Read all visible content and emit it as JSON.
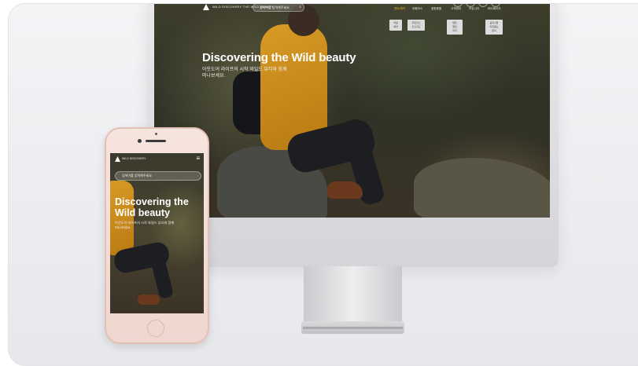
{
  "desktop": {
    "logo_text": "WILD DISCOVERY THE WILD BEAUTY",
    "search_placeholder": "검색어를 입력해주세요",
    "menu": [
      "렌트/예약",
      "여행코스",
      "캠핑용품",
      "고객센터",
      "커뮤니티",
      "마이페이지"
    ],
    "submenus": [
      {
        "items": [
          "차량",
          "예약"
        ]
      },
      {
        "items": [
          "추천코스",
          "코스지도"
        ]
      },
      {
        "items": [
          "텐트",
          "랜턴",
          "의자"
        ]
      },
      {
        "items": [
          "공지사항",
          "자주묻는",
          "문의"
        ]
      }
    ],
    "hero_title": "Discovering the Wild beauty",
    "hero_subtitle": "아웃도어 라이프의 시작 와일드 뷰티와 함께 떠나보세요."
  },
  "phone": {
    "logo_text": "WILD DISCOVERY",
    "search_placeholder": "검색어를 입력해주세요",
    "menu_icon": "hamburger-icon",
    "hero_title": "Discovering the Wild beauty",
    "hero_subtitle": "아웃도어 라이프의 시작 와일드 뷰티와 함께 떠나보세요."
  },
  "colors": {
    "accent": "#e6b01f",
    "jacket": "#d79b25",
    "phone_body": "#f6e4de"
  }
}
